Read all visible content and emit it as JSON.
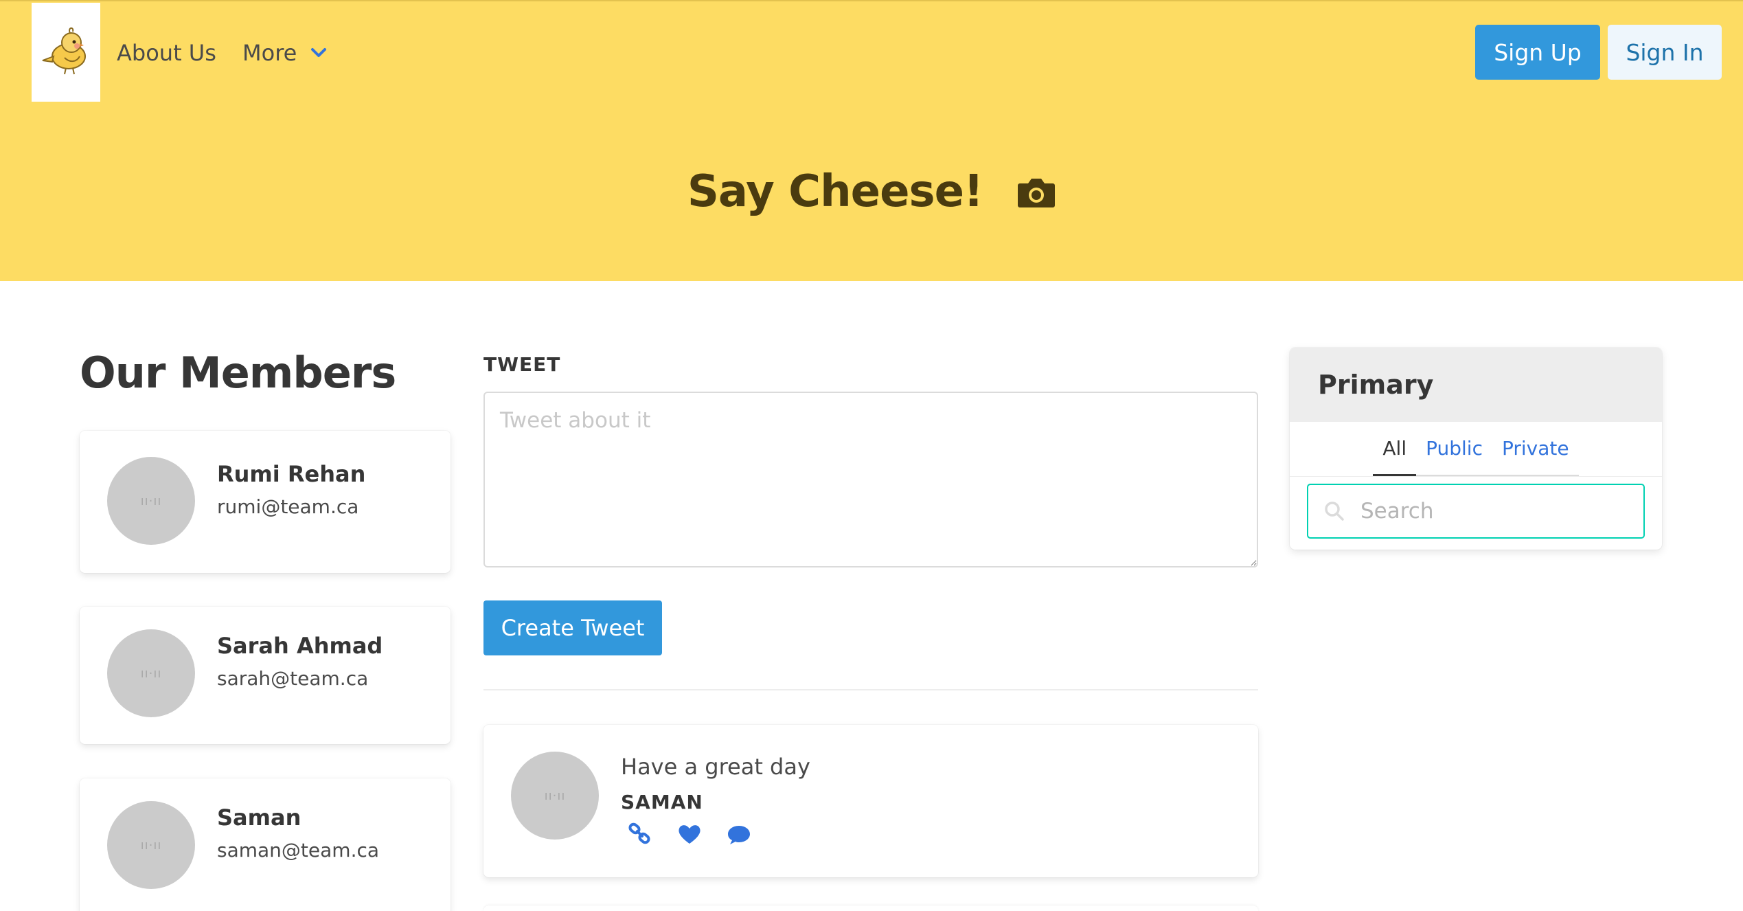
{
  "colors": {
    "hero_bg": "#fddc63",
    "primary_blue": "#3298dc",
    "link_blue": "#3273dc",
    "search_border": "#00d1b2",
    "avatar_gray": "#cbcbcb"
  },
  "nav": {
    "logo_icon": "bird-logo-icon",
    "about_label": "About Us",
    "more_label": "More",
    "more_icon": "chevron-down-icon",
    "signup_label": "Sign Up",
    "signin_label": "Sign In"
  },
  "hero": {
    "title": "Say Cheese!",
    "icon": "camera-icon"
  },
  "members": {
    "title": "Our Members",
    "items": [
      {
        "name": "Rumi Rehan",
        "email": "rumi@team.ca"
      },
      {
        "name": "Sarah Ahmad",
        "email": "sarah@team.ca"
      },
      {
        "name": "Saman",
        "email": "saman@team.ca"
      }
    ]
  },
  "tweet_form": {
    "label": "TWEET",
    "placeholder": "Tweet about it",
    "value": "",
    "submit_label": "Create Tweet"
  },
  "tweets": [
    {
      "text": "Have a great day",
      "author": "SAMAN",
      "actions": [
        "link-icon",
        "heart-icon",
        "comment-icon"
      ]
    }
  ],
  "panel": {
    "heading": "Primary",
    "tabs": [
      {
        "label": "All",
        "active": true
      },
      {
        "label": "Public",
        "active": false
      },
      {
        "label": "Private",
        "active": false
      }
    ],
    "search_placeholder": "Search",
    "search_value": ""
  }
}
